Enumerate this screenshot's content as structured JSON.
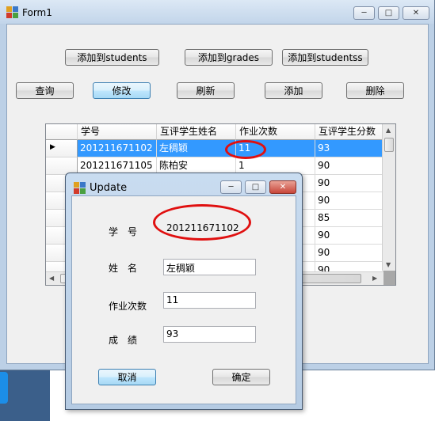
{
  "form1": {
    "title": "Form1",
    "buttons_row1": [
      "添加到students",
      "添加到grades",
      "添加到studentss"
    ],
    "buttons_row2": [
      "查询",
      "修改",
      "刷新",
      "添加",
      "删除"
    ],
    "grid": {
      "columns": [
        "学号",
        "互评学生姓名",
        "作业次数",
        "互评学生分数"
      ],
      "rows": [
        {
          "id": "201211671102",
          "name": "左稠颖",
          "times": "11",
          "score": "93",
          "selected": true
        },
        {
          "id": "201211671105",
          "name": "陈柏安",
          "times": "1",
          "score": "90"
        },
        {
          "id": "",
          "name": "",
          "times": "",
          "score": "90"
        },
        {
          "id": "",
          "name": "",
          "times": "",
          "score": "90"
        },
        {
          "id": "",
          "name": "",
          "times": "",
          "score": "85"
        },
        {
          "id": "",
          "name": "",
          "times": "",
          "score": "90"
        },
        {
          "id": "",
          "name": "",
          "times": "",
          "score": "90"
        },
        {
          "id": "",
          "name": "",
          "times": "",
          "score": "90"
        }
      ],
      "row_indicator": "▶"
    }
  },
  "update": {
    "title": "Update",
    "labels": {
      "id": "学　号",
      "name": "姓　名",
      "times": "作业次数",
      "score": "成　绩"
    },
    "values": {
      "id": "201211671102",
      "name": "左稠颖",
      "times": "11",
      "score": "93"
    },
    "cancel": "取消",
    "ok": "确定"
  },
  "colors": {
    "selection": "#3399ff",
    "annotation": "#e01010"
  },
  "icons": {
    "minimize": "─",
    "maximize": "□",
    "close": "✕"
  }
}
